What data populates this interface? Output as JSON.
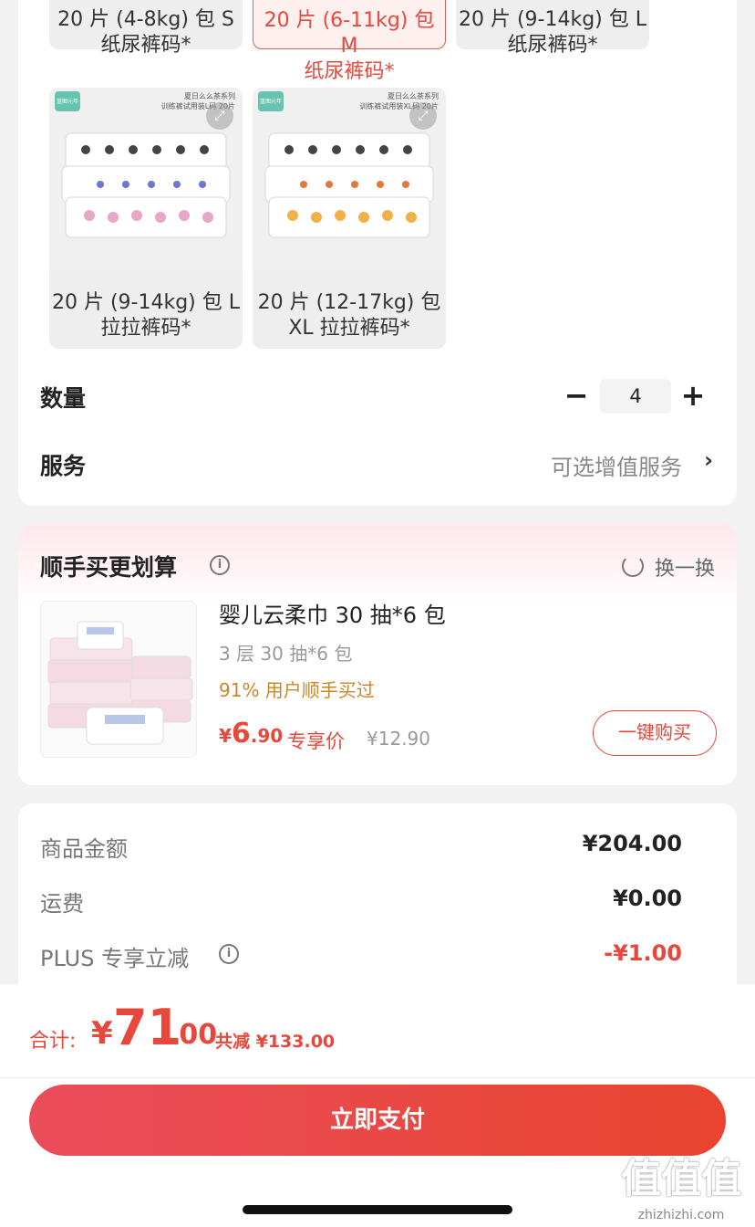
{
  "sku": {
    "variants_top": [
      {
        "line1": "20 片 (4-8kg) 包 S",
        "line2": "纸尿裤码*",
        "selected": false
      },
      {
        "line1": "20 片 (6-11kg) 包 M",
        "line2": "纸尿裤码*",
        "selected": true
      },
      {
        "line1": "20 片 (9-14kg) 包 L",
        "line2": "纸尿裤码*",
        "selected": false
      }
    ],
    "variants_img": [
      {
        "line1": "20 片 (9-14kg) 包 L",
        "line2": "拉拉裤码*",
        "caption1": "夏日么么茶系列",
        "caption2": "训练裤试用装L码 20片",
        "logo": "蓝图元年"
      },
      {
        "line1": "20 片 (12-17kg) 包",
        "line2": "XL 拉拉裤码*",
        "caption1": "夏日么么茶系列",
        "caption2": "训练裤试用装XL码 20片",
        "logo": "蓝图元年"
      }
    ],
    "quantity_label": "数量",
    "quantity_value": "4",
    "minus": "−",
    "plus": "+",
    "service_label": "服务",
    "service_hint": "可选增值服务",
    "chevron": "›"
  },
  "addon": {
    "title": "顺手买更划算",
    "info": "i",
    "swap_label": "换一换",
    "product_name": "婴儿云柔巾 30 抽*6 包",
    "spec": "3 层 30 抽*6 包",
    "social_proof": "91% 用户顺手买过",
    "price_currency": "¥",
    "price_int": "6",
    "price_dec": ".90",
    "price_label": "专享价",
    "orig_price": "¥12.90",
    "buy_button": "一键购买"
  },
  "summary": {
    "rows": [
      {
        "label": "商品金额",
        "value": "¥204.00"
      },
      {
        "label": "运费",
        "value": "¥0.00"
      },
      {
        "label": "PLUS 专享立减",
        "value": "-¥1.00"
      }
    ],
    "info": "i"
  },
  "footer": {
    "total_label": "合计:",
    "total_currency": "¥",
    "total_int": "71",
    "total_dec": ".00",
    "discount": "共减 ¥133.00",
    "pay_button": "立即支付"
  },
  "watermark": {
    "logo": "值值值",
    "site": "zhizhizhi.com"
  },
  "colors": {
    "accent": "#e8473b",
    "social": "#c8872a",
    "background": "#f2f2f2"
  }
}
